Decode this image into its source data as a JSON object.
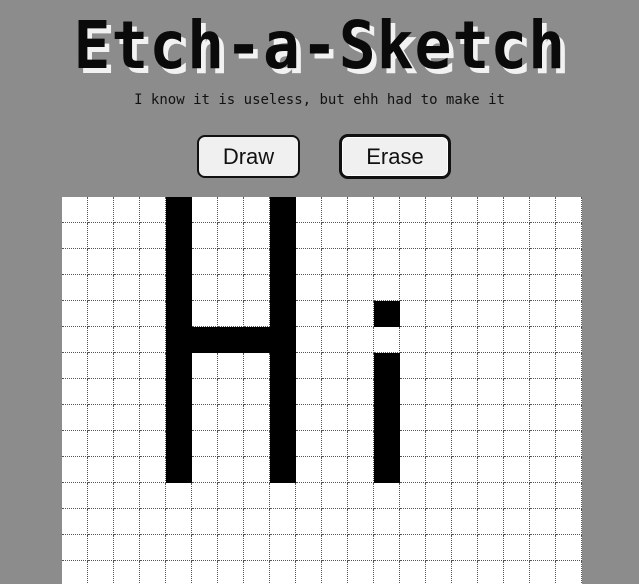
{
  "app": {
    "title": "Etch-a-Sketch",
    "subtitle": "I know it is useless, but ehh had to make it"
  },
  "controls": {
    "draw_label": "Draw",
    "erase_label": "Erase",
    "active_mode": "draw"
  },
  "canvas": {
    "columns": 20,
    "visible_rows": 15,
    "ink_color": "#000000",
    "paper_color": "#ffffff",
    "background_color": "#8c8c8c",
    "filled_cells": [
      [
        0,
        4
      ],
      [
        0,
        8
      ],
      [
        1,
        4
      ],
      [
        1,
        8
      ],
      [
        2,
        4
      ],
      [
        2,
        8
      ],
      [
        3,
        4
      ],
      [
        3,
        8
      ],
      [
        4,
        4
      ],
      [
        4,
        8
      ],
      [
        4,
        12
      ],
      [
        5,
        4
      ],
      [
        5,
        5
      ],
      [
        5,
        6
      ],
      [
        5,
        7
      ],
      [
        5,
        8
      ],
      [
        6,
        4
      ],
      [
        6,
        8
      ],
      [
        6,
        12
      ],
      [
        7,
        4
      ],
      [
        7,
        8
      ],
      [
        7,
        12
      ],
      [
        8,
        4
      ],
      [
        8,
        8
      ],
      [
        8,
        12
      ],
      [
        9,
        4
      ],
      [
        9,
        8
      ],
      [
        9,
        12
      ],
      [
        10,
        4
      ],
      [
        10,
        8
      ],
      [
        10,
        12
      ]
    ]
  }
}
